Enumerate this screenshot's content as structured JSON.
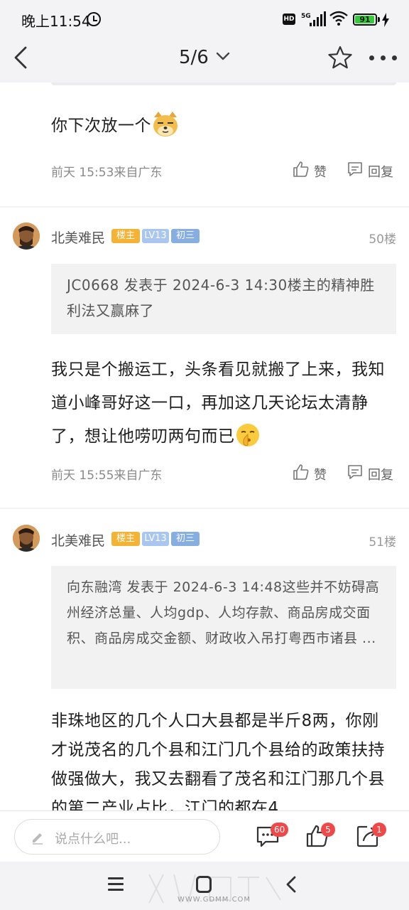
{
  "status_bar": {
    "time": "晚上11:54",
    "network_label": "HD",
    "network_type": "5G",
    "battery_level": "91"
  },
  "nav": {
    "page_indicator": "5/6"
  },
  "top_post": {
    "text": "你下次放一个",
    "meta": "前天 15:53来自广东",
    "like_label": "赞",
    "reply_label": "回复"
  },
  "posts": [
    {
      "username": "北美难民",
      "badge_owner": "楼主",
      "badge_level": "LV13",
      "badge_rank": "初三",
      "floor": "50楼",
      "quote": "JC0668 发表于 2024-6-3 14:30楼主的精神胜利法又赢麻了",
      "text": "我只是个搬运工，头条看见就搬了上来，我知道小峰哥好这一口，再加这几天论坛太清静了，想让他唠叨两句而已",
      "meta": "前天 15:55来自广东",
      "like_label": "赞",
      "reply_label": "回复"
    },
    {
      "username": "北美难民",
      "badge_owner": "楼主",
      "badge_level": "LV13",
      "badge_rank": "初三",
      "floor": "51楼",
      "quote": "向东融湾 发表于 2024-6-3 14:48这些并不妨碍高州经济总量、人均gdp、人均存款、商品房成交面积、商品房成交金额、财政收入吊打粤西市诸县 ...",
      "text": "非珠地区的几个人口大县都是半斤8两，你刚才说茂名的几个县和江门几个县给的政策扶持做强做大，我又去翻看了茂名和江门那几个县的第二产业占比，江门的都在4"
    }
  ],
  "bottom_bar": {
    "placeholder": "说点什么吧...",
    "comment_count": "60",
    "like_count": "5",
    "share_count": "1"
  },
  "colors": {
    "badge_owner": "#f5b335",
    "badge_level": "#a8c6ef",
    "badge_rank": "#86aee0",
    "count_badge": "#f04848"
  },
  "watermark": "WWW.GDMM.COM"
}
